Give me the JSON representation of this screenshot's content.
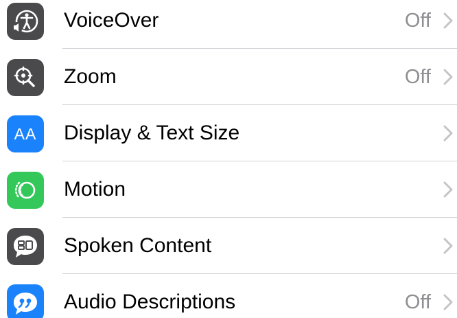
{
  "accessibility_list": {
    "items": [
      {
        "label": "VoiceOver",
        "value": "Off",
        "icon": "voiceover-icon",
        "icon_color": "#4a4a4c"
      },
      {
        "label": "Zoom",
        "value": "Off",
        "icon": "zoom-icon",
        "icon_color": "#4a4a4c"
      },
      {
        "label": "Display & Text Size",
        "value": "",
        "icon": "display-text-size-icon",
        "icon_color": "#1a82fb"
      },
      {
        "label": "Motion",
        "value": "",
        "icon": "motion-icon",
        "icon_color": "#34c759"
      },
      {
        "label": "Spoken Content",
        "value": "",
        "icon": "spoken-content-icon",
        "icon_color": "#4a4a4c"
      },
      {
        "label": "Audio Descriptions",
        "value": "Off",
        "icon": "audio-descriptions-icon",
        "icon_color": "#1a82fb"
      }
    ],
    "display_text_size_icon_glyph": "AA"
  }
}
